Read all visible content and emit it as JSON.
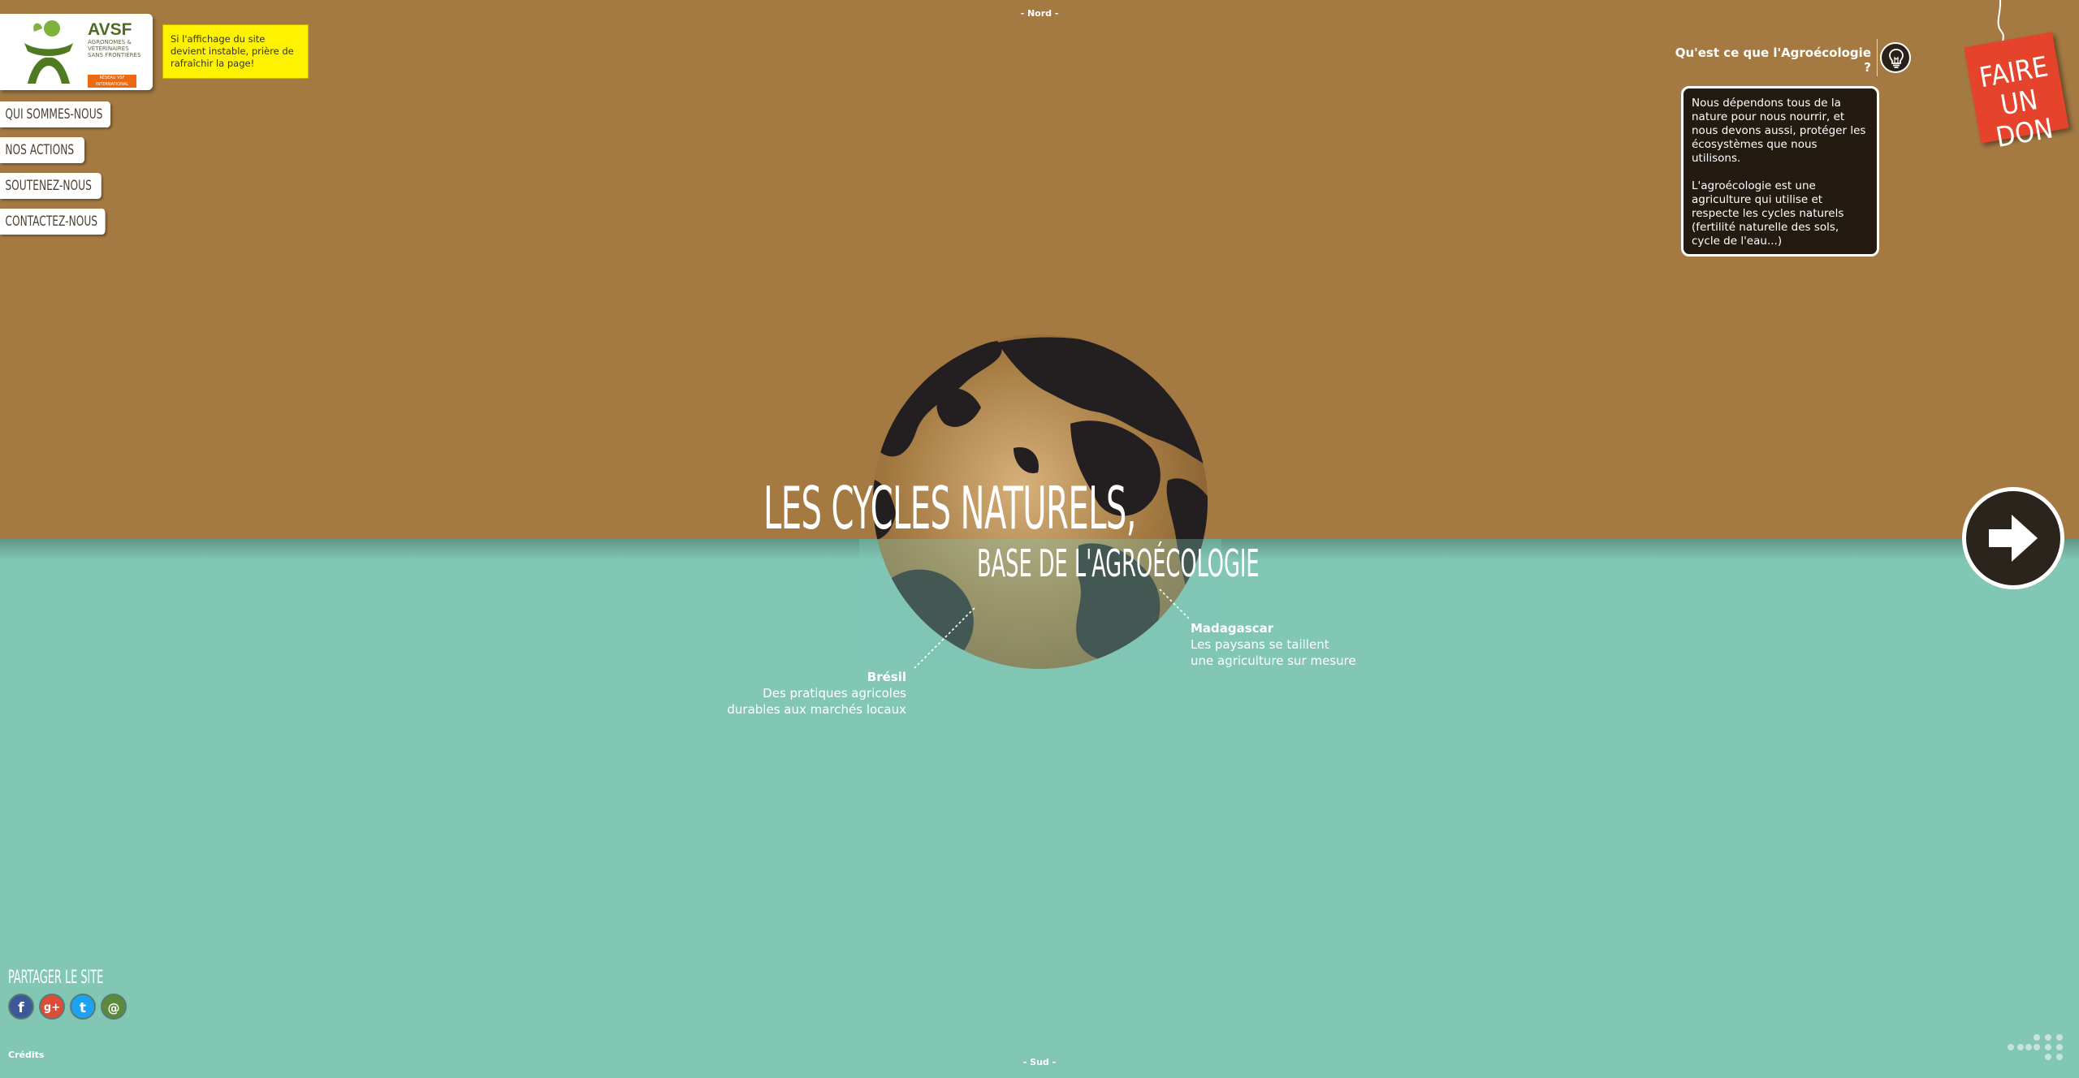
{
  "compass": {
    "north": "- Nord -",
    "south": "- Sud -"
  },
  "logo": {
    "name": "AVSF",
    "subtitle": "AGRONOMES & VÉTÉRINAIRES SANS FRONTIÈRES",
    "tag": "RÉSEAU VSF INTERNATIONAL"
  },
  "notice": "Si l'affichage du site devient instable, prière de rafraîchir la page!",
  "nav": [
    "QUI SOMMES-NOUS",
    "NOS ACTIONS",
    "SOUTENEZ-NOUS",
    "CONTACTEZ-NOUS"
  ],
  "agroecology": {
    "question": "Qu'est ce que l'Agroécologie ?",
    "paragraph1": "Nous dépendons tous de la nature pour nous nourrir, et nous devons aussi, protéger les écosystèmes que nous utilisons.",
    "paragraph2": "L'agroécologie est une agriculture qui utilise et respecte les cycles naturels (fertilité naturelle des sols, cycle de l'eau...)"
  },
  "donate": {
    "line1": "FAIRE",
    "line2": "UN DON"
  },
  "headline": {
    "main": "LES CYCLES NATURELS,",
    "sub": "BASE DE L'AGROÉCOLOGIE"
  },
  "annotations": {
    "bresil": {
      "label": "Brésil",
      "line1": "Des pratiques agricoles",
      "line2": "durables aux marchés locaux"
    },
    "madagascar": {
      "label": "Madagascar",
      "line1": "Les paysans se taillent",
      "line2": "une agriculture sur mesure"
    }
  },
  "share": {
    "title": "PARTAGER LE SITE",
    "facebook": "f",
    "google": "g+",
    "twitter": "t",
    "email": "@"
  },
  "credits": "Crédits",
  "colors": {
    "earth": "#a47a42",
    "water": "#82c6b4",
    "donate": "#e5432b",
    "notice": "#fff200"
  },
  "icons": {
    "bulb": "lightbulb-icon",
    "next": "arrow-right-icon"
  }
}
